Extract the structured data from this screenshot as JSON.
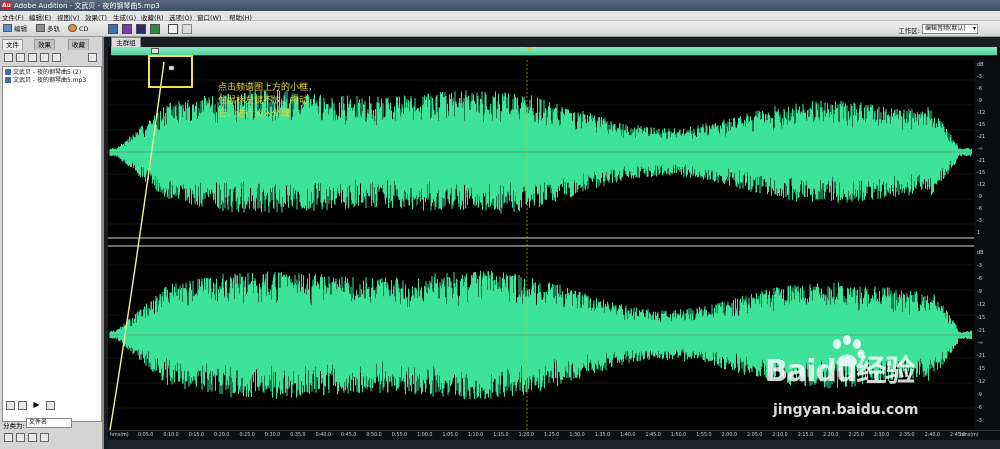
{
  "window": {
    "title": "Adobe Audition - 文武贝 - 夜的钢琴曲5.mp3",
    "app_icon": "Au"
  },
  "menu": [
    "文件(F)",
    "编辑(E)",
    "视图(V)",
    "效果(T)",
    "生成(G)",
    "收藏(R)",
    "选项(O)",
    "窗口(W)",
    "帮助(H)"
  ],
  "toolbar": {
    "edit_label": "编辑",
    "multitrack_label": "多轨",
    "cd_label": "CD",
    "workspace_label": "工作区:",
    "workspace_value": "编辑音频(默认)"
  },
  "left_panel": {
    "tabs": [
      "文件",
      "效果",
      "收藏"
    ],
    "files": [
      "文武贝 - 夜的钢琴曲5 (2)",
      "文武贝 - 夜的钢琴曲5.mp3"
    ],
    "sort_label": "分类为:",
    "sort_value": "文件名"
  },
  "editor": {
    "tab_label": "主群组"
  },
  "db_labels": [
    "dB",
    "-3",
    "-6",
    "-9",
    "-12",
    "-15",
    "-21",
    "-∞",
    "-21",
    "-15",
    "-12",
    "-9",
    "-6",
    "-3",
    "1",
    "dB",
    "-3",
    "-6",
    "-9",
    "-12",
    "-15",
    "-21",
    "-∞",
    "-21",
    "-15",
    "-12",
    "-9",
    "-6",
    "-3"
  ],
  "time_labels": [
    "hms(m)",
    "0:05.0",
    "0:10.0",
    "0:15.0",
    "0:20.0",
    "0:25.0",
    "0:30.0",
    "0:35.0",
    "0:40.0",
    "0:45.0",
    "0:50.0",
    "0:55.0",
    "1:00.0",
    "1:05.0",
    "1:10.0",
    "1:15.0",
    "1:20.0",
    "1:25.0",
    "1:30.0",
    "1:35.0",
    "1:40.0",
    "1:45.0",
    "1:50.0",
    "1:55.0",
    "2:00.0",
    "2:05.0",
    "2:10.0",
    "2:15.0",
    "2:20.0",
    "2:25.0",
    "2:30.0",
    "2:35.0",
    "2:40.0",
    "2:45.0",
    "hms(m)"
  ],
  "annotation": {
    "lines": [
      "点击频谱图上方的小框，",
      "住鼠标左键不放，拖动",
      "它，进行淡入处理"
    ],
    "color": "#e6d73a"
  },
  "watermark": {
    "brand": "Baidu经验",
    "url": "jingyan.baidu.com"
  },
  "colors": {
    "waveform": "#3ee39a",
    "background": "#000000",
    "accent": "#f0e34a"
  }
}
